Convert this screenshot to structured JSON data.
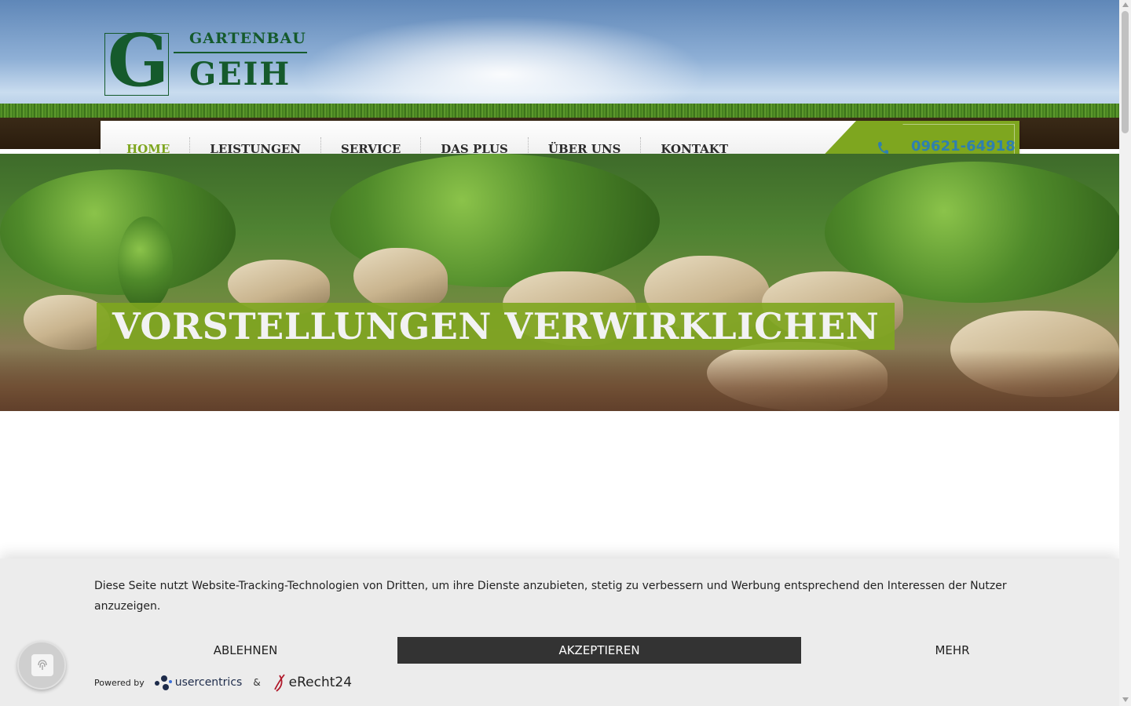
{
  "brand": {
    "logo_letter": "G",
    "name_top": "GARTENBAU",
    "name_bottom": "GEIH",
    "accent_color": "#7ea61f",
    "logo_color": "#155a2c"
  },
  "nav": {
    "items": [
      {
        "label": "HOME",
        "active": true
      },
      {
        "label": "LEISTUNGEN",
        "active": false
      },
      {
        "label": "SERVICE",
        "active": false
      },
      {
        "label": "DAS PLUS",
        "active": false
      },
      {
        "label": "ÜBER UNS",
        "active": false
      },
      {
        "label": "KONTAKT",
        "active": false
      }
    ],
    "phone_icon": "phone-icon",
    "phone_number": "09621-64918"
  },
  "hero": {
    "title": "VORSTELLUNGEN VERWIRKLICHEN"
  },
  "cookie_banner": {
    "text": "Diese Seite nutzt Website-Tracking-Technologien von Dritten, um ihre Dienste anzubieten, stetig zu verbessern und Werbung entsprechend den Interessen der Nutzer anzuzeigen.",
    "decline_label": "ABLEHNEN",
    "accept_label": "AKZEPTIEREN",
    "more_label": "MEHR",
    "powered_by": "Powered by",
    "usercentrics": "usercentrics",
    "ampersand": "&",
    "erecht24": "eRecht24",
    "fingerprint_icon": "fingerprint-icon"
  }
}
